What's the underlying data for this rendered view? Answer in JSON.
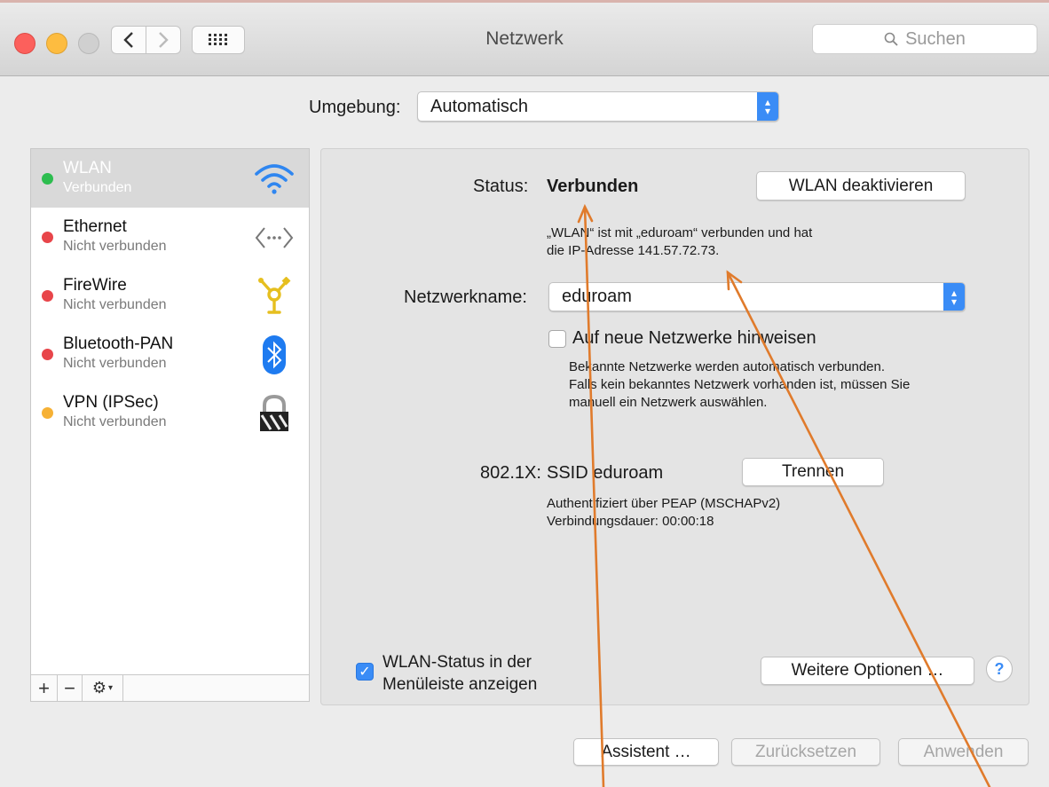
{
  "window": {
    "title": "Netzwerk",
    "search_placeholder": "Suchen"
  },
  "location": {
    "label": "Umgebung:",
    "value": "Automatisch"
  },
  "services": [
    {
      "name": "WLAN",
      "status": "Verbunden",
      "dot_color": "#2dbd4f",
      "icon": "wifi-icon"
    },
    {
      "name": "Ethernet",
      "status": "Nicht verbunden",
      "dot_color": "#e8454a",
      "icon": "ethernet-icon"
    },
    {
      "name": "FireWire",
      "status": "Nicht verbunden",
      "dot_color": "#e8454a",
      "icon": "firewire-icon"
    },
    {
      "name": "Bluetooth-PAN",
      "status": "Nicht verbunden",
      "dot_color": "#e8454a",
      "icon": "bluetooth-icon"
    },
    {
      "name": "VPN (IPSec)",
      "status": "Nicht verbunden",
      "dot_color": "#f6b135",
      "icon": "lock-icon"
    }
  ],
  "sidebar_tools": {
    "add": "+",
    "remove": "−"
  },
  "detail": {
    "status_label": "Status:",
    "status_value": "Verbunden",
    "toggle_button": "WLAN deaktivieren",
    "status_desc_1": "„WLAN“ ist mit „eduroam“ verbunden und hat",
    "status_desc_2": "die IP-Adresse 141.57.72.73.",
    "network_label": "Netzwerkname:",
    "network_value": "eduroam",
    "ask_join_label": "Auf neue Netzwerke hinweisen",
    "ask_join_desc_1": "Bekannte Netzwerke werden automatisch verbunden.",
    "ask_join_desc_2": "Falls kein bekanntes Netzwerk vorhanden ist, müssen Sie",
    "ask_join_desc_3": "manuell ein Netzwerk auswählen.",
    "dot1x_label": "802.1X:",
    "dot1x_value": "SSID eduroam",
    "disconnect_button": "Trennen",
    "auth_line": "Authentifiziert über PEAP (MSCHAPv2)",
    "duration_line": "Verbindungsdauer: 00:00:18",
    "menubar_label_1": "WLAN-Status in der",
    "menubar_label_2": "Menüleiste anzeigen",
    "advanced_button": "Weitere Optionen …",
    "help": "?"
  },
  "footer": {
    "assist": "Assistent …",
    "revert": "Zurücksetzen",
    "apply": "Anwenden"
  },
  "colors": {
    "accent": "#3a8cf6",
    "annotation_arrow": "#e07b2c"
  }
}
